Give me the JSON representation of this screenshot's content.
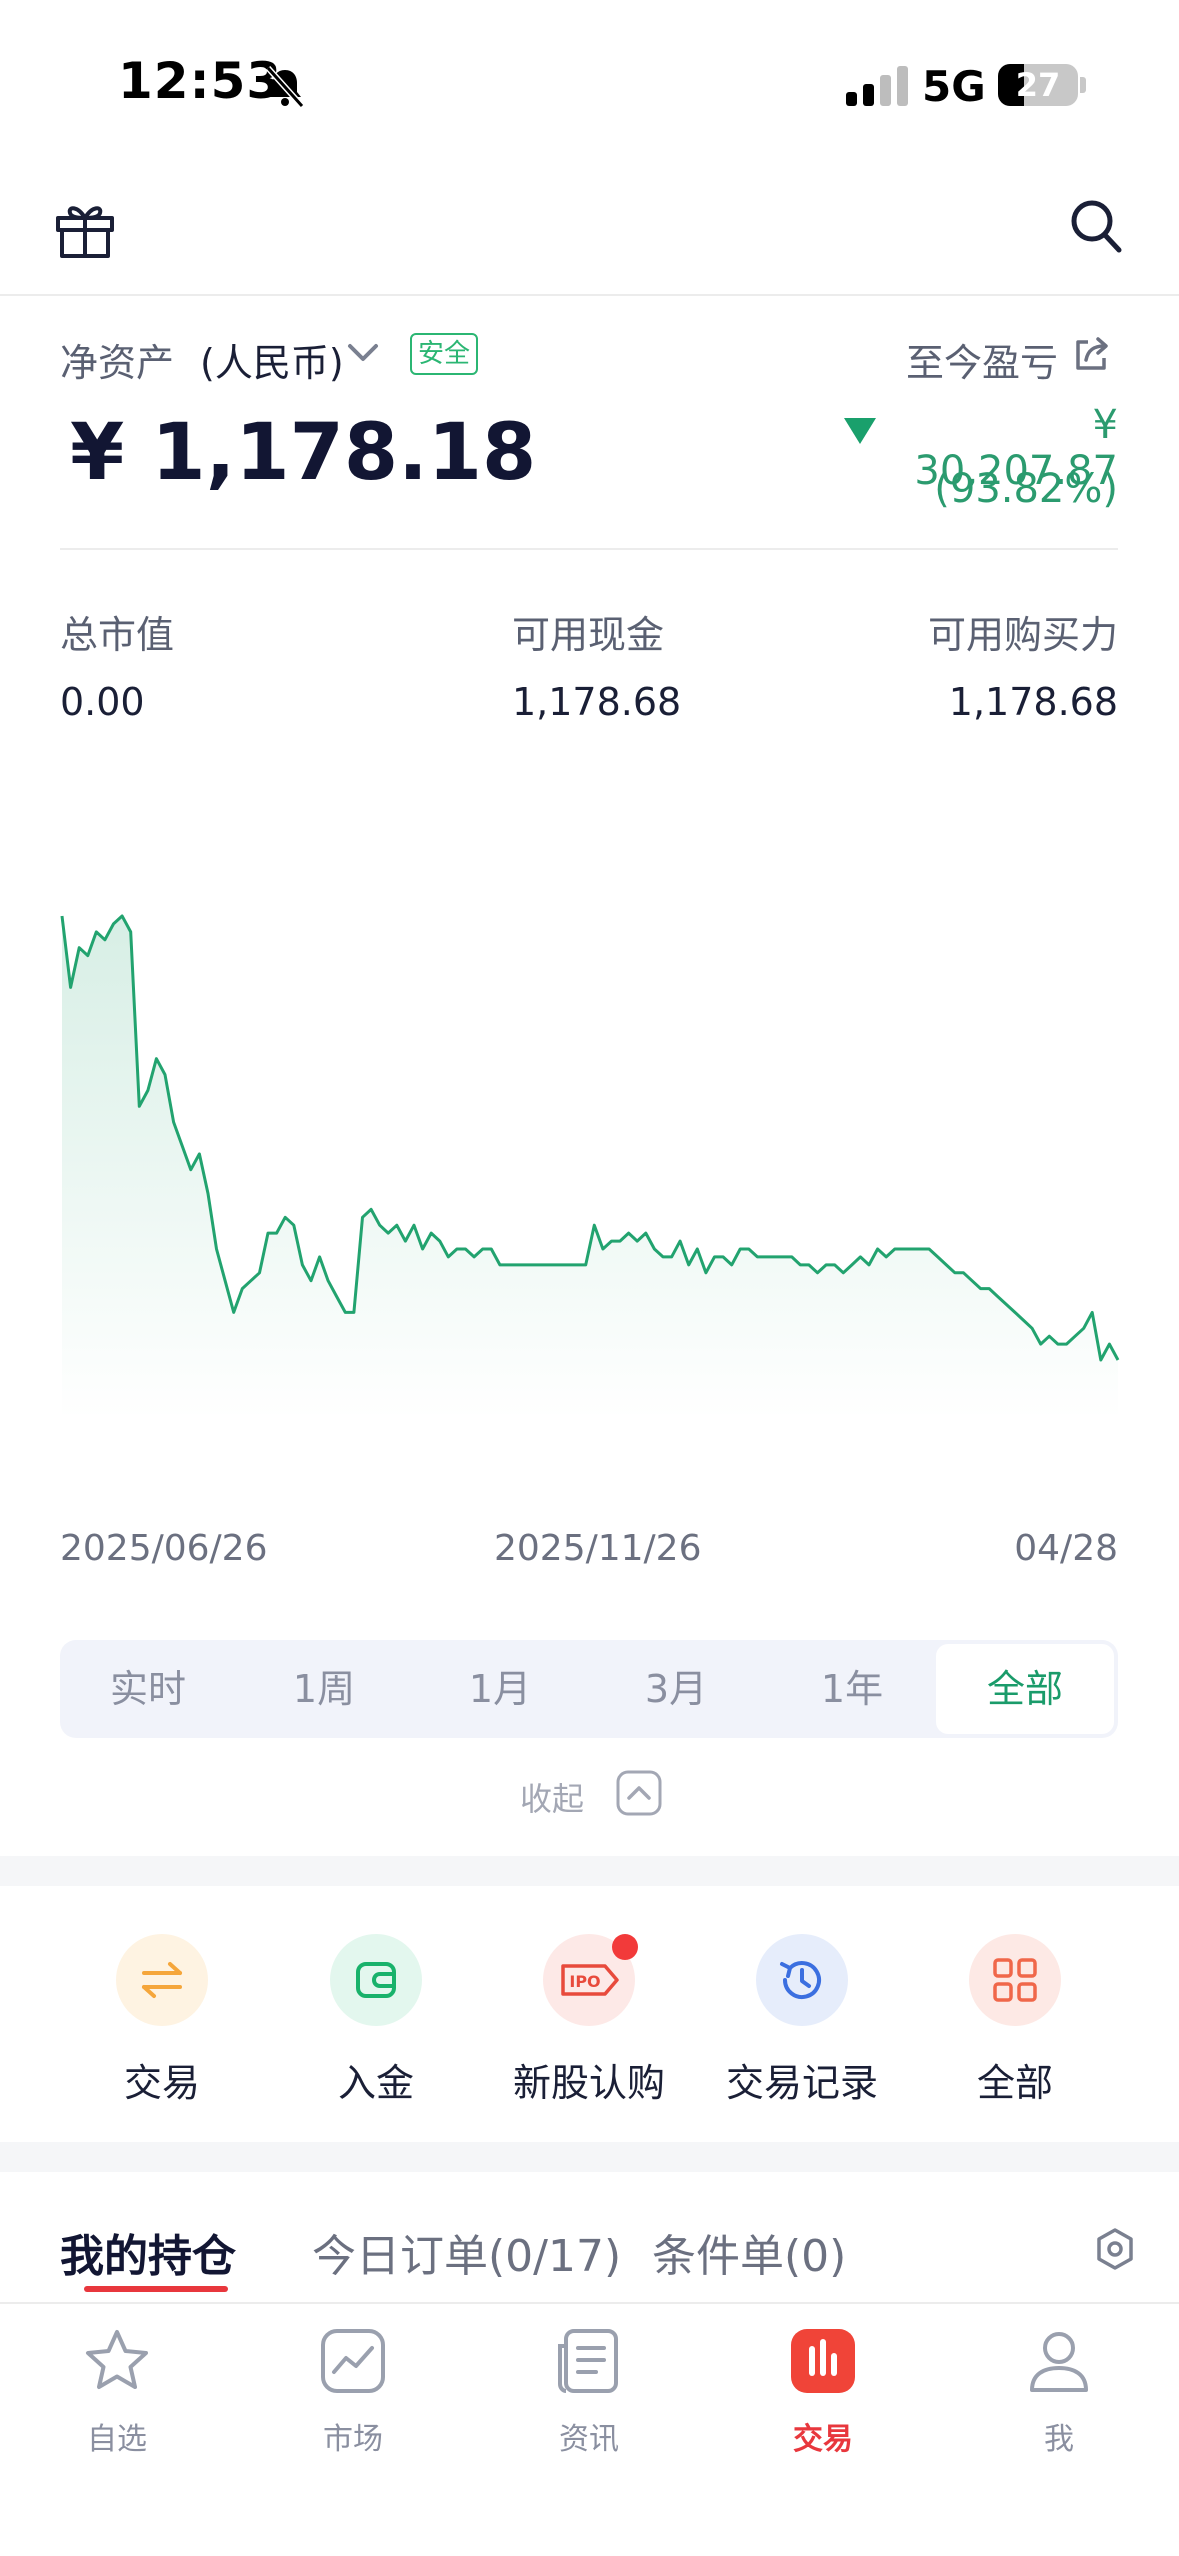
{
  "status_bar": {
    "time": "12:53",
    "network": "5G",
    "battery": "27"
  },
  "account": {
    "net_assets_label": "净资产",
    "currency": "(人民币)",
    "safe_badge": "安全",
    "net_assets_value": "¥ 1,178.18",
    "pl_label": "至今盈亏",
    "pl_amount": "¥ 30,207.87",
    "pl_percent": "(93.82%)"
  },
  "stats": [
    {
      "label": "总市值",
      "value": "0.00"
    },
    {
      "label": "可用现金",
      "value": "1,178.68"
    },
    {
      "label": "可用购买力",
      "value": "1,178.68"
    }
  ],
  "chart_data": {
    "type": "area",
    "x_start": "2025/06/26",
    "x_mid": "2025/11/26",
    "x_end": "04/28",
    "values": [
      100,
      91,
      96,
      95,
      98,
      97,
      99,
      100,
      98,
      76,
      78,
      82,
      80,
      74,
      71,
      68,
      70,
      65,
      58,
      54,
      50,
      53,
      54,
      55,
      60,
      60,
      62,
      61,
      56,
      54,
      57,
      54,
      52,
      50,
      50,
      62,
      63,
      61,
      60,
      61,
      59,
      61,
      58,
      60,
      59,
      57,
      58,
      58,
      57,
      58,
      58,
      56,
      56,
      56,
      56,
      56,
      56,
      56,
      56,
      56,
      56,
      56,
      61,
      58,
      59,
      59,
      60,
      59,
      60,
      58,
      57,
      57,
      59,
      56,
      58,
      55,
      57,
      57,
      56,
      58,
      58,
      57,
      57,
      57,
      57,
      57,
      56,
      56,
      55,
      56,
      56,
      55,
      56,
      57,
      56,
      58,
      57,
      58,
      58,
      58,
      58,
      58,
      57,
      56,
      55,
      55,
      54,
      53,
      53,
      52,
      51,
      50,
      49,
      48,
      46,
      47,
      46,
      46,
      47,
      48,
      50,
      44,
      46,
      44
    ]
  },
  "range_tabs": {
    "items": [
      "实时",
      "1周",
      "1月",
      "3月",
      "1年",
      "全部"
    ],
    "active": "全部"
  },
  "collapse_label": "收起",
  "actions": [
    {
      "label": "交易",
      "icon": "swap-icon",
      "color": "#f5a63b"
    },
    {
      "label": "入金",
      "icon": "wallet-icon",
      "color": "#19b26b"
    },
    {
      "label": "新股认购",
      "icon": "ipo-icon",
      "color": "#e84a3c"
    },
    {
      "label": "交易记录",
      "icon": "history-icon",
      "color": "#3b6fe0"
    },
    {
      "label": "全部",
      "icon": "grid-icon",
      "color": "#f0674a"
    }
  ],
  "holdings_tabs": {
    "items": [
      "我的持仓",
      "今日订单(0/17)",
      "条件单(0)"
    ]
  },
  "bottom_nav": {
    "items": [
      "自选",
      "市场",
      "资讯",
      "交易",
      "我"
    ],
    "active": "交易"
  },
  "colors": {
    "accent_green": "#2b9b6f",
    "accent_red": "#e8373d",
    "line": "#22a36f"
  }
}
